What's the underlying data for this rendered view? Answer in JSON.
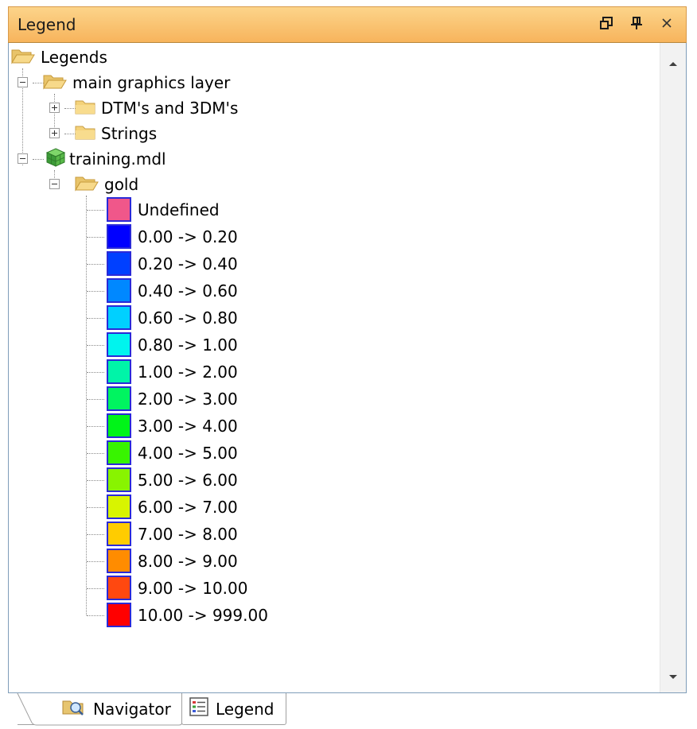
{
  "panel": {
    "title": "Legend",
    "buttons": {
      "float_icon": "window-restore-icon",
      "pin_icon": "pin-icon",
      "close_icon": "close-icon"
    }
  },
  "tree": {
    "root": {
      "label": "Legends",
      "icon": "folder-open-icon"
    },
    "main_layer": {
      "label": "main graphics layer",
      "icon": "folder-open-icon",
      "expanded": true
    },
    "dtm": {
      "label": "DTM's and 3DM's",
      "icon": "folder-icon",
      "expanded": false
    },
    "strings": {
      "label": "Strings",
      "icon": "folder-icon",
      "expanded": false
    },
    "model": {
      "label": "training.mdl",
      "icon": "block-model-cube-icon",
      "expanded": true
    },
    "gold": {
      "label": "gold",
      "icon": "folder-open-icon",
      "expanded": true
    },
    "legend_items": [
      {
        "label": "Undefined",
        "color": "#f0578a"
      },
      {
        "label": "0.00 -> 0.20",
        "color": "#0000ff"
      },
      {
        "label": "0.20 -> 0.40",
        "color": "#0040ff"
      },
      {
        "label": "0.40 -> 0.60",
        "color": "#0088ff"
      },
      {
        "label": "0.60 -> 0.80",
        "color": "#00d0ff"
      },
      {
        "label": "0.80 -> 1.00",
        "color": "#00f4ee"
      },
      {
        "label": "1.00 -> 2.00",
        "color": "#00f4a8"
      },
      {
        "label": "2.00 -> 3.00",
        "color": "#00f460"
      },
      {
        "label": "3.00 -> 4.00",
        "color": "#00f418"
      },
      {
        "label": "4.00 -> 5.00",
        "color": "#38f400"
      },
      {
        "label": "5.00 -> 6.00",
        "color": "#88f400"
      },
      {
        "label": "6.00 -> 7.00",
        "color": "#d8f400"
      },
      {
        "label": "7.00 -> 8.00",
        "color": "#ffcc00"
      },
      {
        "label": "8.00 -> 9.00",
        "color": "#ff8c00"
      },
      {
        "label": "9.00 -> 10.00",
        "color": "#ff4810"
      },
      {
        "label": "10.00 -> 999.00",
        "color": "#ff0000"
      }
    ]
  },
  "tabs": [
    {
      "label": "Navigator",
      "icon": "folder-search-icon",
      "active": false
    },
    {
      "label": "Legend",
      "icon": "legend-list-icon",
      "active": true
    }
  ]
}
